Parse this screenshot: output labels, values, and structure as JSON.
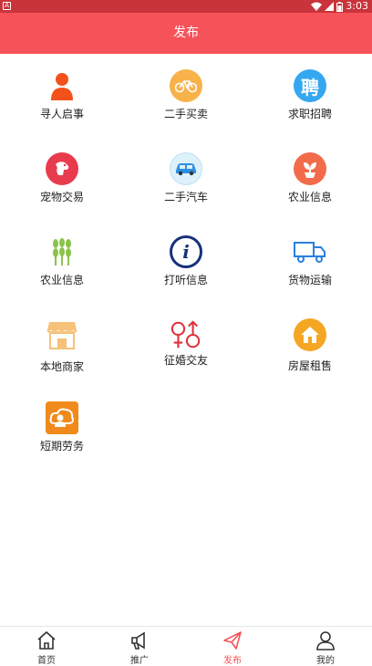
{
  "status_bar": {
    "time": "3:03",
    "app_badge": "A"
  },
  "header": {
    "title": "发布"
  },
  "categories": [
    {
      "label": "寻人启事",
      "icon": "person-icon"
    },
    {
      "label": "二手买卖",
      "icon": "bicycle-icon"
    },
    {
      "label": "求职招聘",
      "icon": "recruit-icon",
      "glyph": "聘"
    },
    {
      "label": "宠物交易",
      "icon": "dog-icon"
    },
    {
      "label": "二手汽车",
      "icon": "car-icon"
    },
    {
      "label": "农业信息",
      "icon": "plant-icon"
    },
    {
      "label": "农业信息",
      "icon": "wheat-icon"
    },
    {
      "label": "打听信息",
      "icon": "info-icon",
      "glyph": "i"
    },
    {
      "label": "货物运输",
      "icon": "truck-icon"
    },
    {
      "label": "本地商家",
      "icon": "shop-icon"
    },
    {
      "label": "征婚交友",
      "icon": "gender-icon"
    },
    {
      "label": "房屋租售",
      "icon": "house-icon"
    },
    {
      "label": "短期劳务",
      "icon": "worker-icon"
    }
  ],
  "tabbar": [
    {
      "label": "首页",
      "icon": "home-icon"
    },
    {
      "label": "推广",
      "icon": "megaphone-icon"
    },
    {
      "label": "发布",
      "icon": "send-icon",
      "active": true
    },
    {
      "label": "我的",
      "icon": "user-icon"
    }
  ],
  "colors": {
    "header": "#f6525a",
    "status_bar": "#c9343a",
    "active_tab": "#f6525a"
  }
}
